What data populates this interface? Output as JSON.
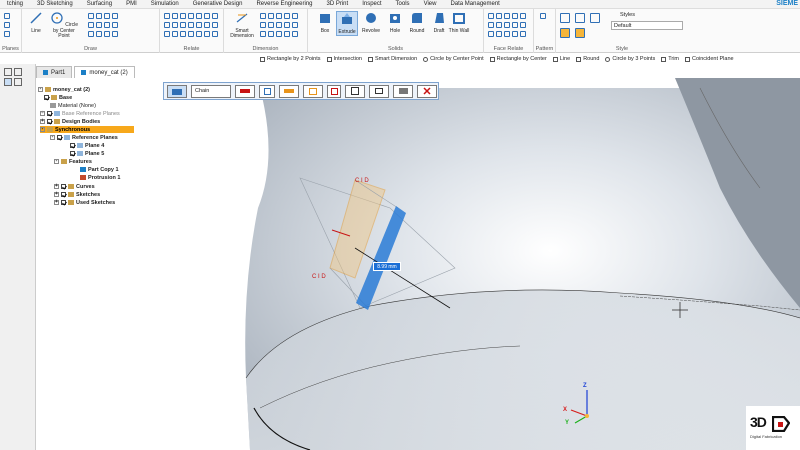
{
  "menu": {
    "tabs": [
      "tching",
      "3D Sketching",
      "Surfacing",
      "PMI",
      "Simulation",
      "Generative Design",
      "Reverse Engineering",
      "3D Print",
      "Inspect",
      "Tools",
      "View",
      "Data Management"
    ],
    "brand": "SIEME"
  },
  "ribbon": {
    "groups": {
      "planes": "Planes",
      "draw": "Draw",
      "relate": "Relate",
      "dimension": "Dimension",
      "solids": "Solids",
      "face_relate": "Face Relate",
      "pattern": "Pattern",
      "style": "Style"
    },
    "buttons": {
      "line": "Line",
      "circle": "Circle by Center Point",
      "smart_dimension": "Smart Dimension",
      "box": "Box",
      "extrude": "Extrude",
      "revolve": "Revolve",
      "hole": "Hole",
      "round": "Round",
      "draft": "Draft",
      "thin_wall": "Thin Wall"
    },
    "styles_label": "Styles",
    "styles_value": "Default"
  },
  "command_bar": {
    "items": [
      "Rectangle by 2 Points",
      "Intersection",
      "Smart Dimension",
      "Circle by Center Point",
      "Rectangle by Center",
      "Line",
      "Round",
      "Circle by 3 Points",
      "Trim",
      "Coincident Plane"
    ]
  },
  "doc_tabs": [
    "Part1",
    "money_cat (2)"
  ],
  "tree": {
    "root": "money_cat (2)",
    "base": "Base",
    "material": "Material (None)",
    "base_ref_planes": "Base Reference Planes",
    "design_bodies": "Design Bodies",
    "synchronous": "Synchronous",
    "reference_planes": "Reference Planes",
    "plane4": "Plane 4",
    "plane5": "Plane 5",
    "features": "Features",
    "part_copy": "Part Copy 1",
    "protrusion": "Protrusion 1",
    "curves": "Curves",
    "sketches": "Sketches",
    "used_sketches": "Used Sketches"
  },
  "quickbar": {
    "chain": "Chain"
  },
  "viewport": {
    "dimension_value": "8.99 mm",
    "axes": {
      "x": "X",
      "y": "Y",
      "z": "Z"
    }
  },
  "logo": {
    "text_3d": "3D",
    "tagline": "Digital Fabrication"
  },
  "colors": {
    "accent": "#1b7fc6",
    "highlight": "#f7a81b",
    "sketch": "#e8941b",
    "extrude": "#2a7bd6"
  }
}
